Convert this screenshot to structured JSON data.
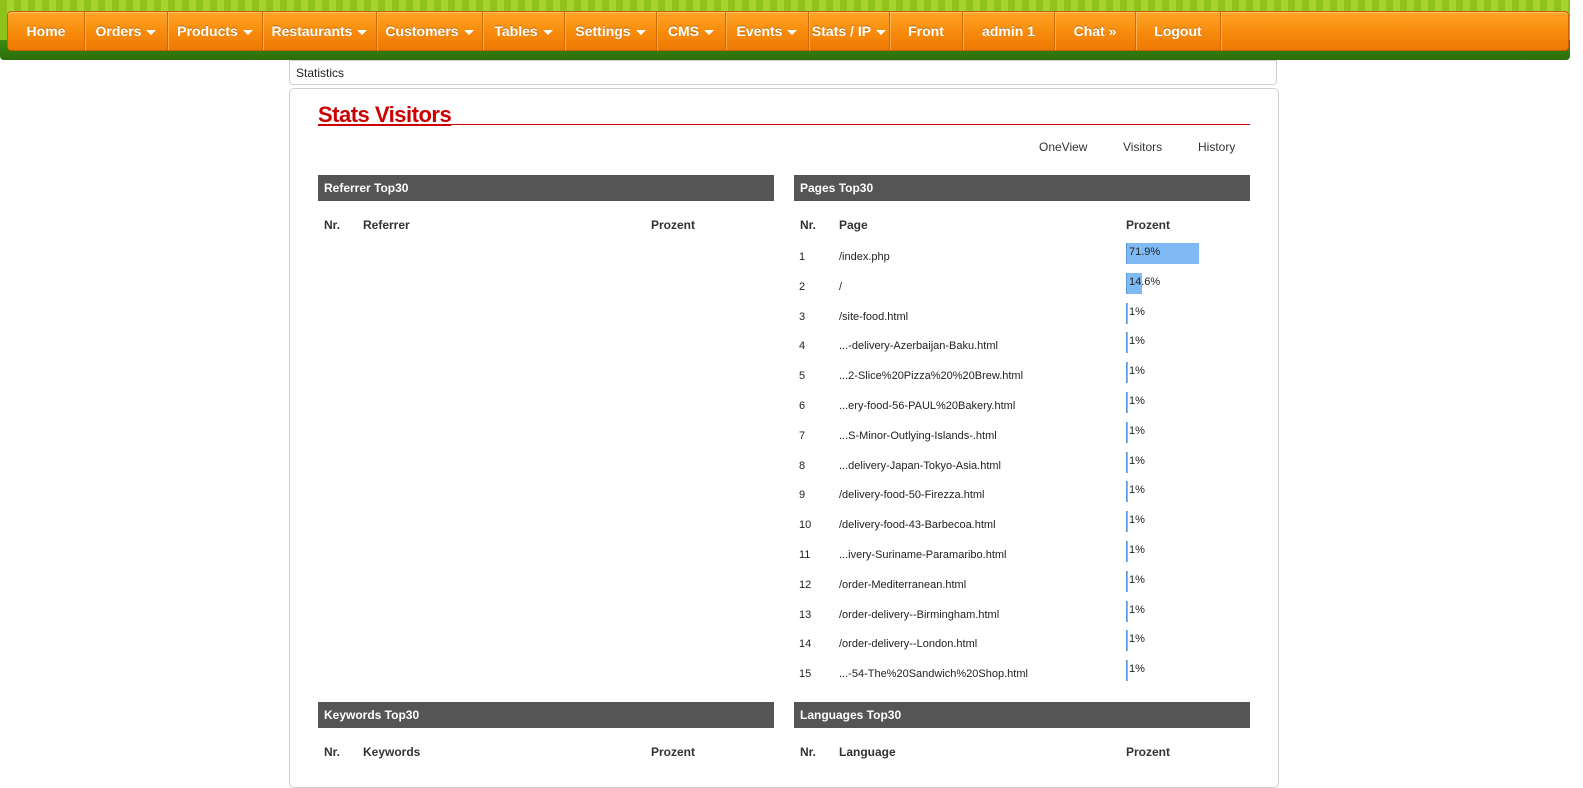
{
  "nav": {
    "items": [
      {
        "label": "Home",
        "dropdown": false
      },
      {
        "label": "Orders",
        "dropdown": true
      },
      {
        "label": "Products",
        "dropdown": true
      },
      {
        "label": "Restaurants",
        "dropdown": true
      },
      {
        "label": "Customers",
        "dropdown": true
      },
      {
        "label": "Tables",
        "dropdown": true
      },
      {
        "label": "Settings",
        "dropdown": true
      },
      {
        "label": "CMS",
        "dropdown": true
      },
      {
        "label": "Events",
        "dropdown": true
      },
      {
        "label": "Stats / IP",
        "dropdown": true
      },
      {
        "label": "Front",
        "dropdown": false
      },
      {
        "label": "admin 1",
        "dropdown": false
      },
      {
        "label": "Chat »",
        "dropdown": false
      },
      {
        "label": "Logout",
        "dropdown": false
      }
    ]
  },
  "breadcrumb": "Statistics",
  "page_title": "Stats Visitors",
  "subnav": [
    "OneView",
    "Visitors",
    "History"
  ],
  "referrer": {
    "title": "Referrer Top30",
    "columns": [
      "Nr.",
      "Referrer",
      "Prozent"
    ]
  },
  "pages": {
    "title": "Pages Top30",
    "columns": [
      "Nr.",
      "Page",
      "Prozent"
    ],
    "rows": [
      {
        "nr": "1",
        "page": "/index.php",
        "pct": "71.9%",
        "value": 71.9
      },
      {
        "nr": "2",
        "page": "/",
        "pct": "14.6%",
        "value": 14.6
      },
      {
        "nr": "3",
        "page": "/site-food.html",
        "pct": "1%",
        "value": 1
      },
      {
        "nr": "4",
        "page": "...-delivery-Azerbaijan-Baku.html",
        "pct": "1%",
        "value": 1
      },
      {
        "nr": "5",
        "page": "...2-Slice%20Pizza%20%20Brew.html",
        "pct": "1%",
        "value": 1
      },
      {
        "nr": "6",
        "page": "...ery-food-56-PAUL%20Bakery.html",
        "pct": "1%",
        "value": 1
      },
      {
        "nr": "7",
        "page": "...S-Minor-Outlying-Islands-.html",
        "pct": "1%",
        "value": 1
      },
      {
        "nr": "8",
        "page": "...delivery-Japan-Tokyo-Asia.html",
        "pct": "1%",
        "value": 1
      },
      {
        "nr": "9",
        "page": "/delivery-food-50-Firezza.html",
        "pct": "1%",
        "value": 1
      },
      {
        "nr": "10",
        "page": "/delivery-food-43-Barbecoa.html",
        "pct": "1%",
        "value": 1
      },
      {
        "nr": "11",
        "page": "...ivery-Suriname-Paramaribo.html",
        "pct": "1%",
        "value": 1
      },
      {
        "nr": "12",
        "page": "/order-Mediterranean.html",
        "pct": "1%",
        "value": 1
      },
      {
        "nr": "13",
        "page": "/order-delivery--Birmingham.html",
        "pct": "1%",
        "value": 1
      },
      {
        "nr": "14",
        "page": "/order-delivery--London.html",
        "pct": "1%",
        "value": 1
      },
      {
        "nr": "15",
        "page": "...-54-The%20Sandwich%20Shop.html",
        "pct": "1%",
        "value": 1
      }
    ]
  },
  "keywords": {
    "title": "Keywords Top30",
    "columns": [
      "Nr.",
      "Keywords",
      "Prozent"
    ]
  },
  "languages": {
    "title": "Languages Top30",
    "columns": [
      "Nr.",
      "Language",
      "Prozent"
    ]
  },
  "colors": {
    "nav_orange": "#f78a0b",
    "title_red": "#cc0000",
    "section_head": "#555555",
    "bar_blue": "#7fbaf5"
  }
}
